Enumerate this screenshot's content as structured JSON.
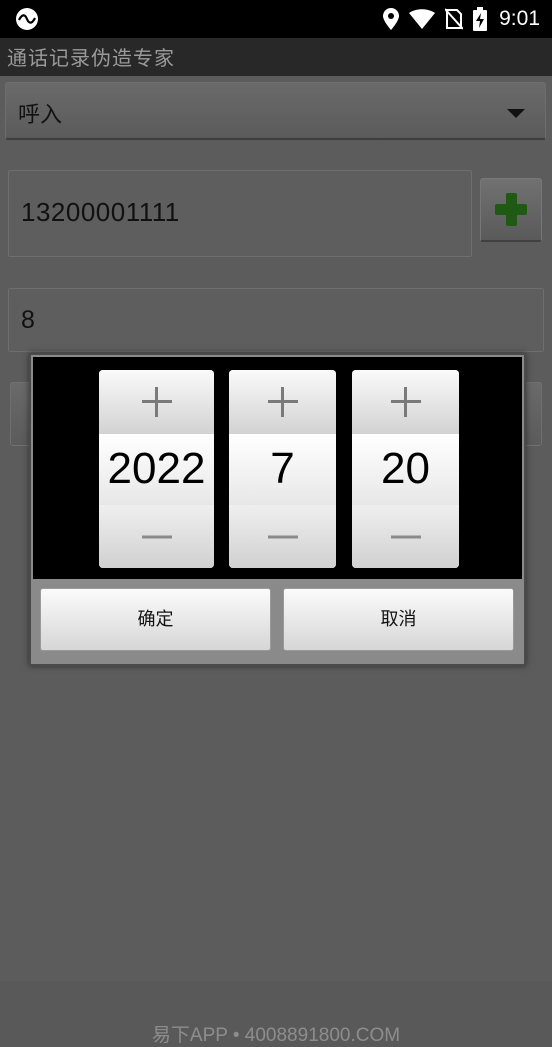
{
  "status_bar": {
    "time": "9:01",
    "icons": [
      "app-notification-icon",
      "location-icon",
      "wifi-icon",
      "no-sim-icon",
      "battery-charging-icon"
    ]
  },
  "app": {
    "title": "通话记录伪造专家"
  },
  "form": {
    "call_type": "呼入",
    "phone_number": "13200001111",
    "duration": "8"
  },
  "date_dialog": {
    "year": "2022",
    "month": "7",
    "day": "20",
    "confirm_label": "确定",
    "cancel_label": "取消"
  },
  "watermark": "易下APP • 4008891800.COM",
  "colors": {
    "add_accent": "#2f8a1f",
    "dim_background": "#5c5c5c"
  }
}
